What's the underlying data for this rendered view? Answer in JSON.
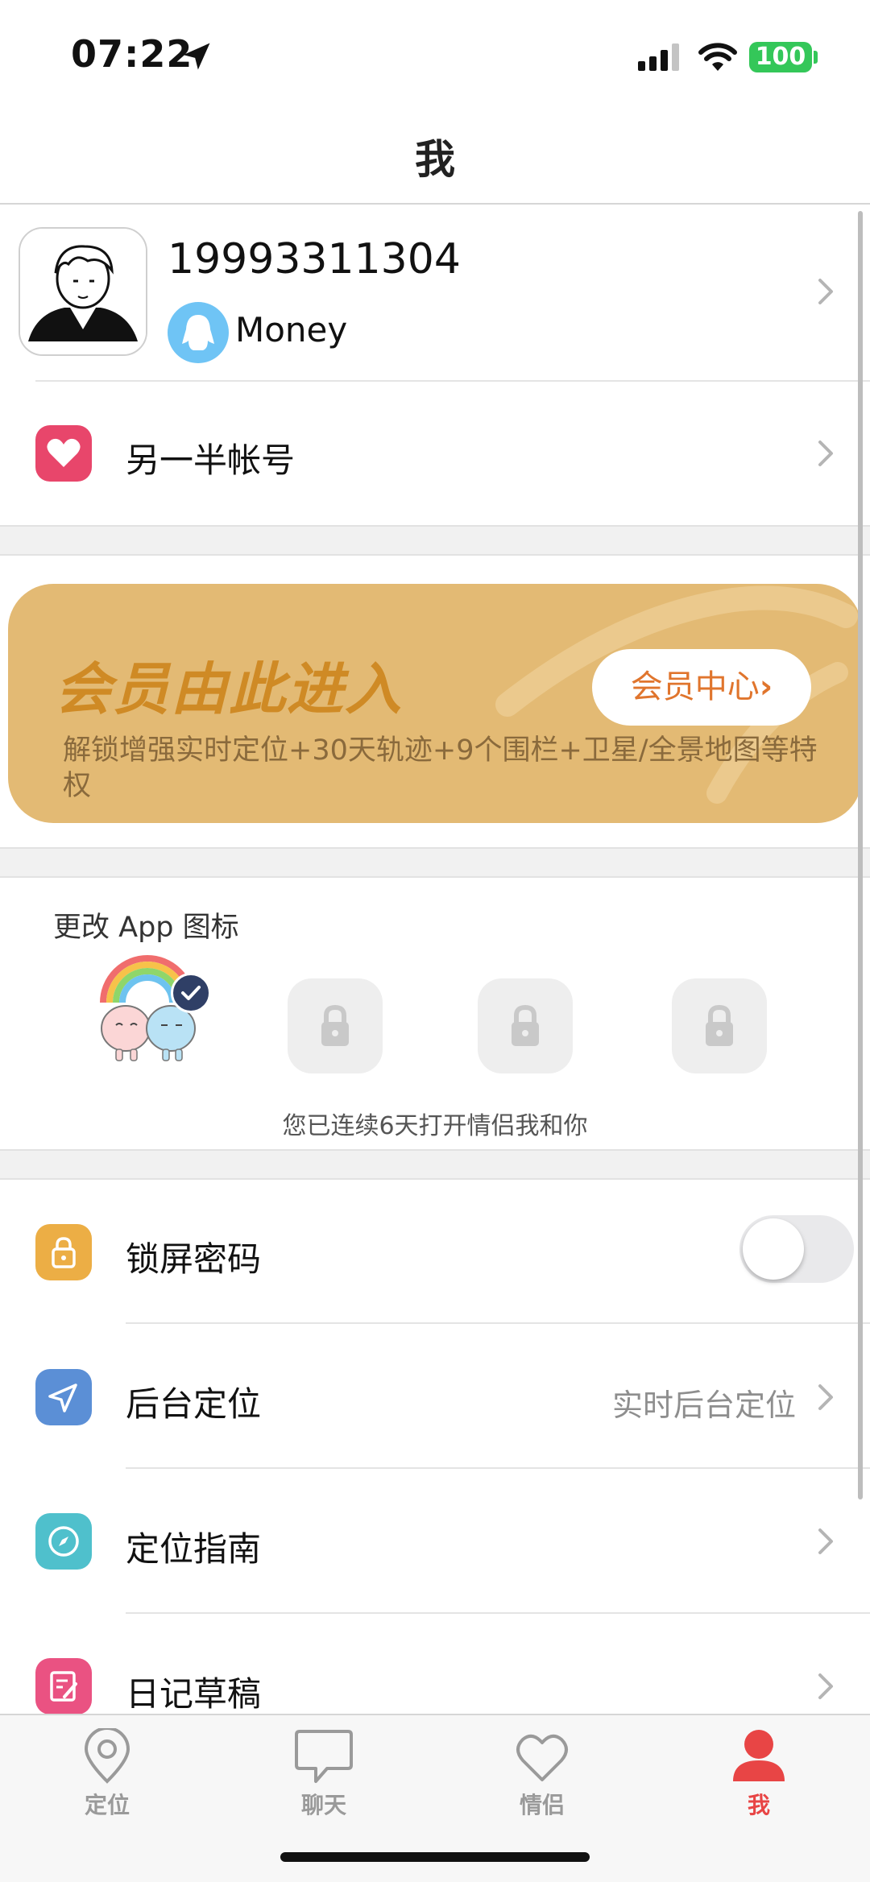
{
  "status_bar": {
    "time": "07:22",
    "battery": "100"
  },
  "nav": {
    "title": "我"
  },
  "profile": {
    "phone": "19993311304",
    "nickname": "Money"
  },
  "partner_row": {
    "label": "另一半帐号"
  },
  "vip": {
    "title": "会员由此进入",
    "button_label": "会员中心",
    "description": "解锁增强实时定位+30天轨迹+9个围栏+卫星/全景地图等特权"
  },
  "app_icon": {
    "title": "更改 App 图标",
    "streak_text": "您已连续6天打开情侣我和你"
  },
  "settings": [
    {
      "label": "锁屏密码",
      "icon": "lock-icon",
      "color": "#ecae45",
      "toggle_on": false
    },
    {
      "label": "后台定位",
      "icon": "navigation-arrow-icon",
      "color": "#5b8fd6",
      "value": "实时后台定位"
    },
    {
      "label": "定位指南",
      "icon": "compass-icon",
      "color": "#4fc0cc"
    },
    {
      "label": "日记草稿",
      "icon": "edit-note-icon",
      "color": "#ea5282"
    }
  ],
  "tabbar": {
    "items": [
      {
        "label": "定位",
        "icon": "location-pin-icon",
        "active": false
      },
      {
        "label": "聊天",
        "icon": "chat-bubble-icon",
        "active": false
      },
      {
        "label": "情侣",
        "icon": "heart-icon",
        "active": false
      },
      {
        "label": "我",
        "icon": "person-icon",
        "active": true
      }
    ]
  },
  "colors": {
    "accent_red": "#e84545",
    "partner_icon": "#e8466b",
    "vip_background": "#e3ba74",
    "vip_title": "#cf8a25",
    "vip_button_text": "#e0752d",
    "qq_blue": "#6fc4f5"
  }
}
